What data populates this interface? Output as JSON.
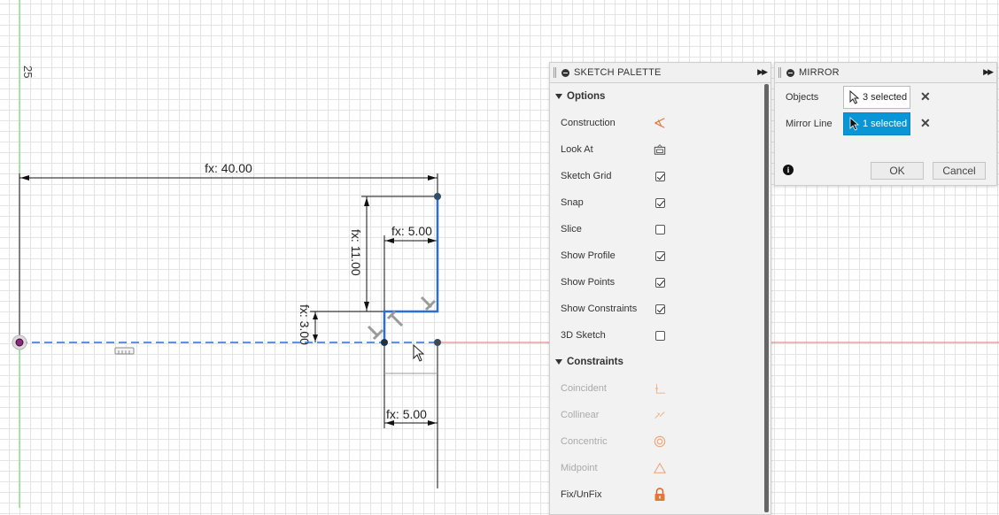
{
  "canvas": {
    "axis_value": "25",
    "dimensions": {
      "top_width": "fx: 40.00",
      "upper_height": "fx: 11.00",
      "upper_width": "fx: 5.00",
      "lower_height": "fx: 3.00",
      "bottom_width": "fx: 5.00"
    }
  },
  "palette": {
    "title": "SKETCH PALETTE",
    "options_heading": "Options",
    "options": [
      {
        "label": "Construction",
        "icon": "construction-icon"
      },
      {
        "label": "Look At",
        "icon": "look-at-icon"
      },
      {
        "label": "Sketch Grid",
        "checked": true
      },
      {
        "label": "Snap",
        "checked": true
      },
      {
        "label": "Slice",
        "checked": false
      },
      {
        "label": "Show Profile",
        "checked": true
      },
      {
        "label": "Show Points",
        "checked": true
      },
      {
        "label": "Show Constraints",
        "checked": true
      },
      {
        "label": "3D Sketch",
        "checked": false
      }
    ],
    "constraints_heading": "Constraints",
    "constraints": [
      {
        "label": "Coincident",
        "icon": "coincident-icon"
      },
      {
        "label": "Collinear",
        "icon": "collinear-icon"
      },
      {
        "label": "Concentric",
        "icon": "concentric-icon"
      },
      {
        "label": "Midpoint",
        "icon": "midpoint-icon"
      },
      {
        "label": "Fix/UnFix",
        "icon": "lock-icon"
      }
    ]
  },
  "mirror": {
    "title": "MIRROR",
    "objects_label": "Objects",
    "objects_value": "3 selected",
    "mirror_line_label": "Mirror Line",
    "mirror_line_value": "1 selected",
    "ok_label": "OK",
    "cancel_label": "Cancel"
  },
  "colors": {
    "selection_blue": "#0a96d6",
    "sketch_line": "#2a6fd6",
    "axis_green": "#5fd35f",
    "axis_red": "#e07070",
    "icon_orange": "#e0793a"
  }
}
